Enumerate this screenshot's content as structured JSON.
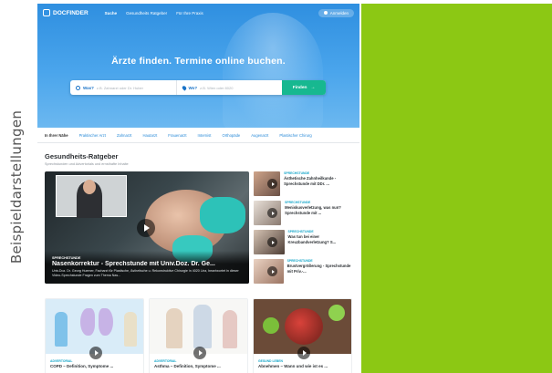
{
  "side_caption": "Beispieldarstellungen",
  "colors": {
    "green_panel": "#8cc814",
    "hero_blue": "#2f8fe0",
    "accent_teal": "#17b890"
  },
  "nav": {
    "logo": "DOCFINDER",
    "links": [
      "Suche",
      "Gesundheits Ratgeber",
      "Für Ihre Praxis"
    ],
    "login": "Anmelden"
  },
  "hero": {
    "title": "Ärzte finden. Termine online buchen.",
    "search": {
      "what_label": "Was?",
      "what_placeholder": "z.B. Zahnarzt oder Dr. Huber",
      "where_label": "Wo?",
      "where_placeholder": "z.B. Wien oder 8020",
      "button": "Finden"
    }
  },
  "categories": [
    "In Ihrer Nähe",
    "Praktischer Arzt",
    "Zahnarzt",
    "Hautarzt",
    "Frauenarzt",
    "Internist",
    "Orthopäde",
    "Augenarzt",
    "Plastischer Chirurg"
  ],
  "ratgeber": {
    "title": "Gesundheits-Ratgeber",
    "subtitle": "Sprechstunden und Advertorials und ernsthafte Inhalte",
    "feature": {
      "tag": "SPRECHSTUNDE",
      "title": "Nasenkorrektur - Sprechstunde mit Univ.Doz. Dr. Ge...",
      "desc": "Univ.Doz. Dr. Georg Huemer, Facharzt für Plastische, Ästhetische u. Rekonstruktive Chirurgie in 4020 Linz, beantwortet in dieser Video-Sprechstunde Fragen zum Thema Nas..."
    },
    "side_items": [
      {
        "tag": "SPRECHSTUNDE",
        "title": "Ästhetische Zahnheilkunde - Sprechstunde mit DDr. ..."
      },
      {
        "tag": "SPRECHSTUNDE",
        "title": "Meniskusverletzung, was nun? Sprechstunde mit ..."
      },
      {
        "tag": "SPRECHSTUNDE",
        "title": "Was tun bei einer Kreuzbandverletzung? S..."
      },
      {
        "tag": "SPRECHSTUNDE",
        "title": "Brustvergrößerung - Sprechstunde mit Priv.-..."
      }
    ],
    "cards": [
      {
        "tag": "ADVERTORIAL",
        "title": "COPD – Definition, Symptome ..."
      },
      {
        "tag": "ADVERTORIAL",
        "title": "Asthma – Definition, Symptome ..."
      },
      {
        "tag": "GESUND LEBEN",
        "title": "Abnehmen – Wann und wie ist es ..."
      }
    ]
  }
}
